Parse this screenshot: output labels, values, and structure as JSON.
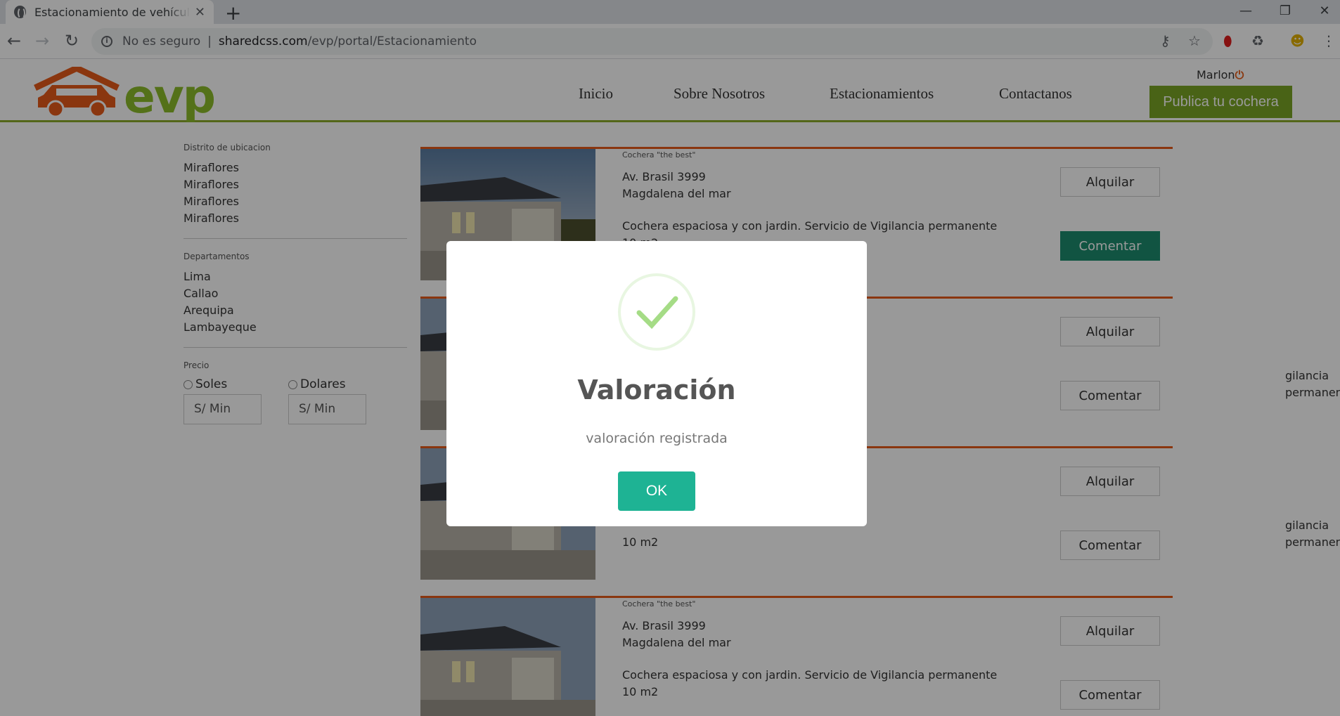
{
  "browser": {
    "tab_title": "Estacionamiento de vehículos pa",
    "new_tab": "+",
    "security_label": "No es seguro",
    "url_host": "sharedcss.com",
    "url_path": "/evp/portal/Estacionamiento"
  },
  "site": {
    "brand": "evp",
    "nav": [
      "Inicio",
      "Sobre Nosotros",
      "Estacionamientos",
      "Contactanos"
    ],
    "user": "Marlon",
    "publish_label": "Publica tu cochera",
    "colors": {
      "accent_green": "#7aa625",
      "accent_orange": "#e65a1a",
      "button_teal": "#1eb394"
    }
  },
  "filters": {
    "district_title": "Distrito de ubicacion",
    "districts": [
      "Miraflores",
      "Miraflores",
      "Miraflores",
      "Miraflores"
    ],
    "dept_title": "Departamentos",
    "departments": [
      "Lima",
      "Callao",
      "Arequipa",
      "Lambayeque"
    ],
    "price_title": "Precio",
    "currency_1": "Soles",
    "currency_2": "Dolares",
    "min_placeholder_1": "S/ Min",
    "min_placeholder_2": "S/ Min"
  },
  "listings": [
    {
      "label": "Cochera \"the best\"",
      "address": "Av. Brasil 3999",
      "district": "Magdalena del mar",
      "description": "Cochera espaciosa y con jardin. Servicio de Vigilancia permanente",
      "size": "10 m2",
      "rent": "Alquilar",
      "comment": "Comentar"
    },
    {
      "label": "",
      "address": "",
      "district": "",
      "description": "gilancia permanente",
      "size": "",
      "rent": "Alquilar",
      "comment": "Comentar"
    },
    {
      "label": "",
      "address": "",
      "district": "",
      "description": "gilancia permanente",
      "size": "10 m2",
      "rent": "Alquilar",
      "comment": "Comentar"
    },
    {
      "label": "Cochera \"the best\"",
      "address": "Av. Brasil 3999",
      "district": "Magdalena del mar",
      "description": "Cochera espaciosa y con jardin. Servicio de Vigilancia permanente",
      "size": "10 m2",
      "rent": "Alquilar",
      "comment": "Comentar"
    }
  ],
  "modal": {
    "title": "Valoración",
    "text": "valoración registrada",
    "ok_label": "OK"
  }
}
